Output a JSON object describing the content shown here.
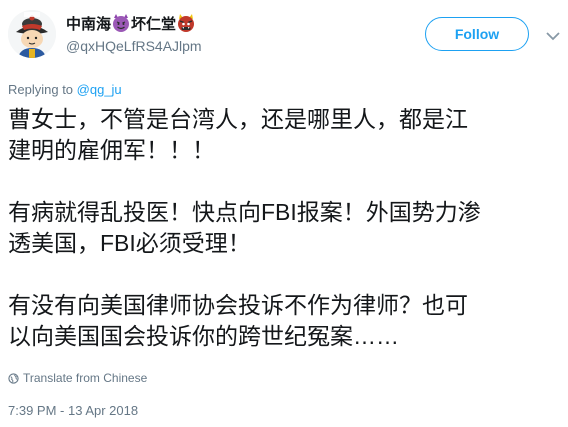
{
  "author": {
    "name_part1": "中南海",
    "name_part2": "坏仁堂",
    "handle": "@qxHQeLfRS4AJlpm",
    "avatar_icon": "qing-official-cartoon-avatar",
    "emoji_1": "smiling-imp-emoji",
    "emoji_2": "ogre-emoji"
  },
  "actions": {
    "follow_label": "Follow",
    "more_icon": "chevron-down-icon"
  },
  "reply_context": {
    "prefix": "Replying to ",
    "mention": "@qg_ju"
  },
  "tweet": {
    "lines": [
      "曹女士，不管是台湾人，还是哪里人，都是江",
      "建明的雇佣军！！！",
      "",
      "有病就得乱投医！快点向FBI报案！外国势力渗",
      "透美国，FBI必须受理！",
      "",
      "有没有向美国律师协会投诉不作为律师？也可",
      "以向美国国会投诉你的跨世纪冤案……"
    ]
  },
  "translate": {
    "label": "Translate from Chinese",
    "icon": "globe-icon"
  },
  "timestamp": "7:39 PM - 13 Apr 2018",
  "colors": {
    "accent": "#1da1f2",
    "secondary_text": "#657786",
    "primary_text": "#14171a"
  }
}
